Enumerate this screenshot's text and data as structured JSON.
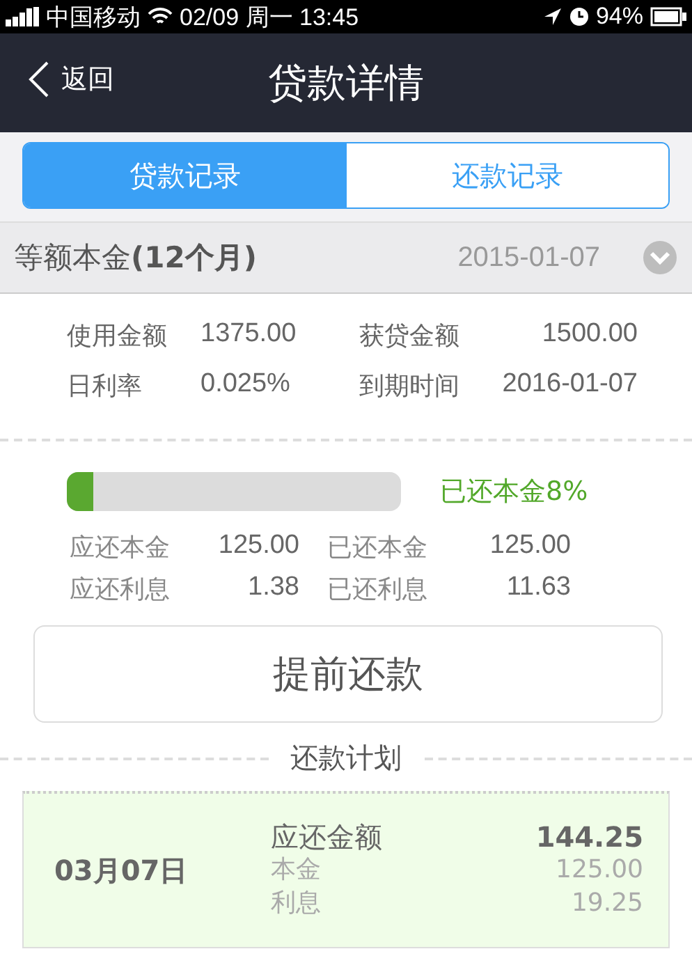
{
  "status_bar": {
    "carrier": "中国移动",
    "time": "02/09 周一 13:45",
    "battery": "94%"
  },
  "nav": {
    "back": "返回",
    "title": "贷款详情"
  },
  "tabs": [
    {
      "label": "贷款记录",
      "selected": true
    },
    {
      "label": "还款记录",
      "selected": false
    }
  ],
  "loan": {
    "title": "等额本金**(12个月)**",
    "date": "2015-01-07",
    "expanded": true,
    "info": [
      {
        "label": "使用金额",
        "value": "1375.00"
      },
      {
        "label": "获贷金额",
        "value": "1500.00"
      },
      {
        "label": "日利率",
        "value": "0.025%"
      },
      {
        "label": "到期时间",
        "value": "2016-01-07"
      }
    ]
  },
  "progress": {
    "level": 0.08,
    "reading": "已还本金8%",
    "stats": [
      {
        "label": "应还本金",
        "value": "125.00"
      },
      {
        "label": "已还本金",
        "value": "125.00"
      },
      {
        "label": "应还利息",
        "value": "1.38"
      },
      {
        "label": "已还利息",
        "value": "11.63"
      }
    ]
  },
  "prepay_button": "提前还款",
  "plan": {
    "title": "还款计划",
    "items": [
      {
        "date": "03月07日",
        "total_label": "应还金额",
        "total": "144.25",
        "principal_label": "本金",
        "principal": "125.00",
        "interest_label": "利息",
        "interest": "19.25"
      }
    ]
  }
}
